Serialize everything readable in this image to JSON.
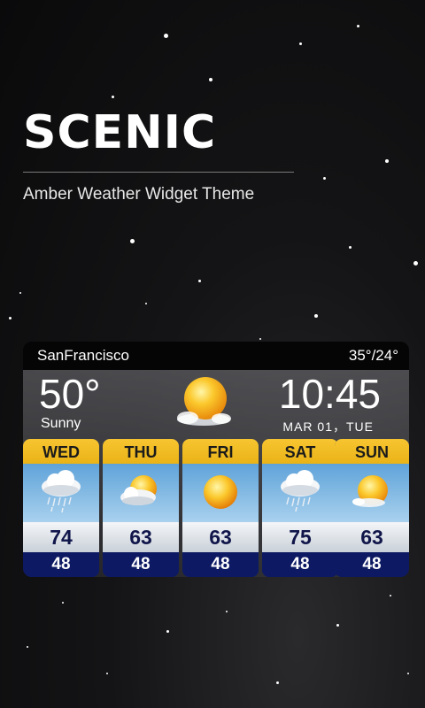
{
  "theme": {
    "title": "SCENIC",
    "subtitle": "Amber Weather Widget Theme"
  },
  "widget": {
    "city": "SanFrancisco",
    "hi_lo": "35°/24°",
    "current_temp": "50°",
    "condition": "Sunny",
    "current_icon": "sun-cloud-icon",
    "time": "10:45",
    "date": "MAR 01，TUE"
  },
  "forecast": [
    {
      "day": "WED",
      "high": "74",
      "low": "48",
      "icon": "cloud-rain-icon"
    },
    {
      "day": "THU",
      "high": "63",
      "low": "48",
      "icon": "sun-cloud-icon"
    },
    {
      "day": "FRI",
      "high": "63",
      "low": "48",
      "icon": "sun-icon"
    },
    {
      "day": "SAT",
      "high": "75",
      "low": "48",
      "icon": "cloud-rain-icon"
    },
    {
      "day": "SUN",
      "high": "63",
      "low": "48",
      "icon": "sun-cloud-icon"
    }
  ],
  "colors": {
    "accent_yellow": "#f7c531",
    "deep_blue": "#0d1a63",
    "sky_blue": "#5fa3d9"
  }
}
